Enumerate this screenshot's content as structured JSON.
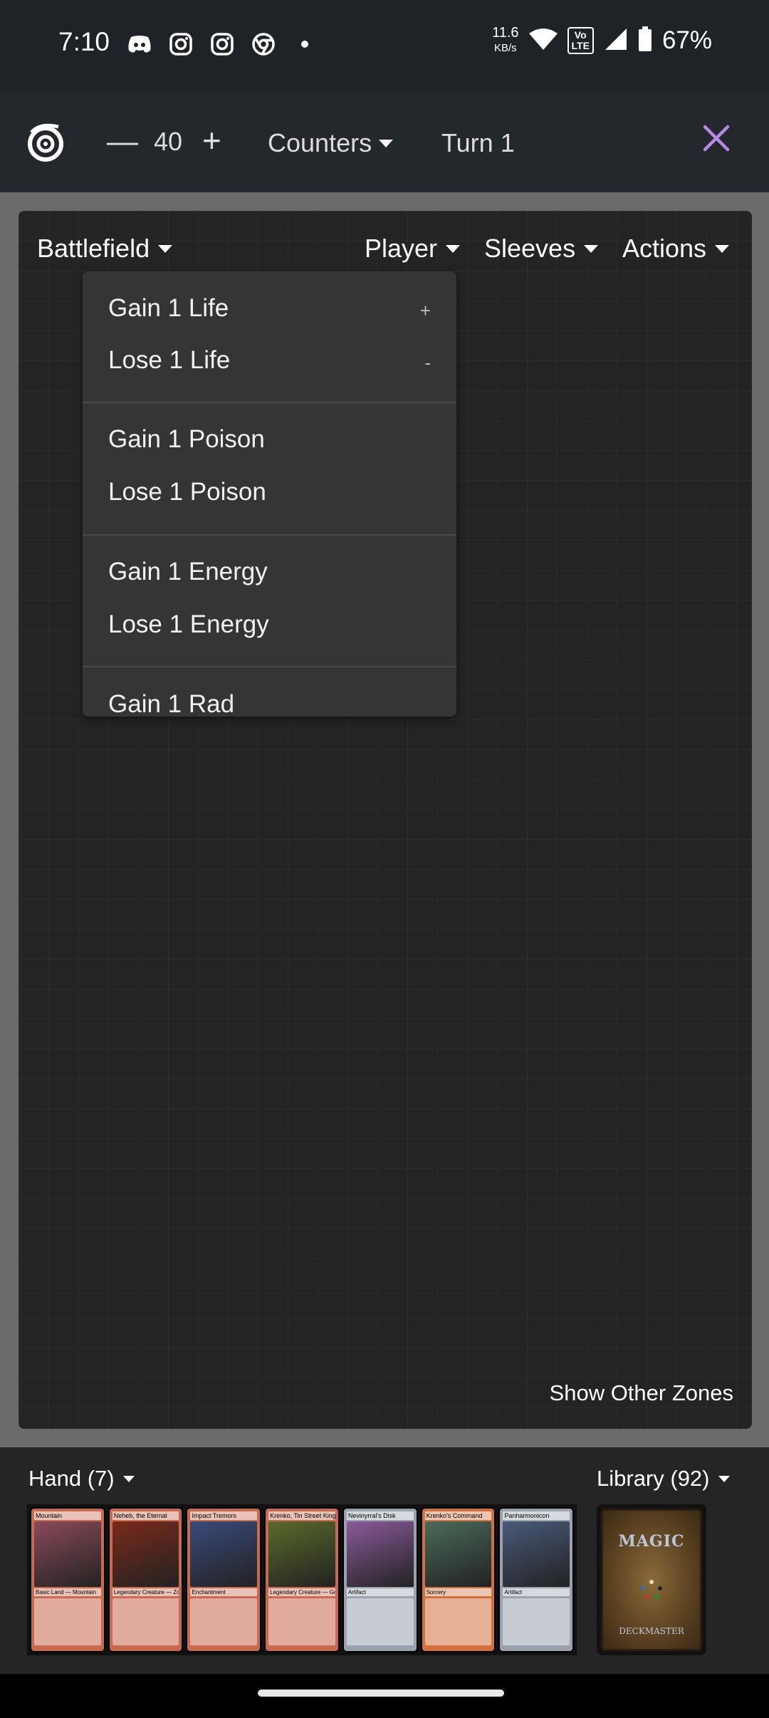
{
  "status_bar": {
    "time": "7:10",
    "icons_left": [
      "discord-icon",
      "instagram-icon",
      "instagram-icon",
      "chrome-icon",
      "dot-icon"
    ],
    "net_speed_value": "11.6",
    "net_speed_unit": "KB/s",
    "volte_top": "Vo",
    "volte_bottom": "LTE",
    "battery_percent": "67%"
  },
  "top_bar": {
    "life_minus": "—",
    "life_value": "40",
    "life_plus": "+",
    "counters_label": "Counters",
    "turn_label": "Turn 1"
  },
  "board": {
    "zone_label": "Battlefield",
    "menus": [
      "Player",
      "Sleeves",
      "Actions"
    ],
    "show_other_zones": "Show Other Zones"
  },
  "dropdown": {
    "items": [
      {
        "label": "Gain 1 Life",
        "key": "+"
      },
      {
        "label": "Lose 1 Life",
        "key": "-"
      },
      {
        "label": "Gain 1 Poison",
        "key": ""
      },
      {
        "label": "Lose 1 Poison",
        "key": ""
      },
      {
        "label": "Gain 1 Energy",
        "key": ""
      },
      {
        "label": "Lose 1 Energy",
        "key": ""
      },
      {
        "label": "Gain 1 Rad",
        "key": ""
      }
    ]
  },
  "hand": {
    "label": "Hand (7)",
    "cards": [
      {
        "name": "Mountain",
        "type": "Basic Land — Mountain",
        "color": "#c9694f"
      },
      {
        "name": "Neheb, the Eternal",
        "type": "Legendary Creature — Zombie Minotaur",
        "color": "#c9694f"
      },
      {
        "name": "Impact Tremors",
        "type": "Enchantment",
        "color": "#c9694f"
      },
      {
        "name": "Krenko, Tin Street Kingpin",
        "type": "Legendary Creature — Goblin",
        "color": "#c9694f"
      },
      {
        "name": "Nevinyrral's Disk",
        "type": "Artifact",
        "color": "#9aa3ad"
      },
      {
        "name": "Krenko's Command",
        "type": "Sorcery",
        "color": "#d2703e"
      },
      {
        "name": "Panharmonicon",
        "type": "Artifact",
        "color": "#9aa3ad"
      }
    ]
  },
  "library": {
    "label": "Library (92)",
    "back_title": "MAGIC",
    "back_subtitle": "DECKMASTER"
  },
  "colors": {
    "accent_close": "#b48ae6",
    "board_bg": "#242424",
    "menu_bg": "#353535"
  }
}
